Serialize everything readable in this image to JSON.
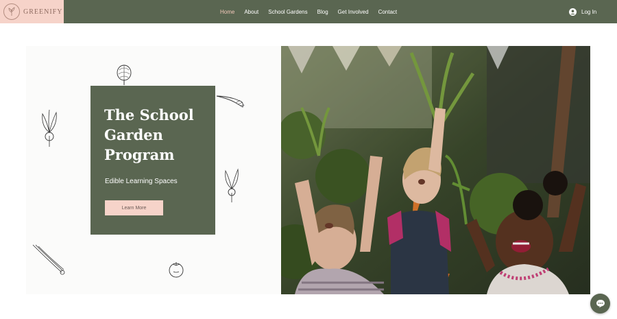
{
  "brand": {
    "name": "GREENIFY"
  },
  "nav": {
    "items": [
      {
        "label": "Home",
        "active": true
      },
      {
        "label": "About",
        "active": false
      },
      {
        "label": "School Gardens",
        "active": false
      },
      {
        "label": "Blog",
        "active": false
      },
      {
        "label": "Get Involved",
        "active": false
      },
      {
        "label": "Contact",
        "active": false
      }
    ],
    "login_label": "Log In"
  },
  "hero": {
    "title_lines": [
      "The School",
      "Garden",
      "Program"
    ],
    "subtitle": "Edible Learning Spaces",
    "cta_label": "Learn More",
    "photo_icon": "children-holding-vegetables-photo"
  },
  "colors": {
    "header_bg": "#5a6651",
    "logo_bg": "#f6d3c9",
    "card_bg": "#5a6651",
    "button_bg": "#f6d3c9",
    "active_nav": "#f3c8ba"
  },
  "chat": {
    "icon": "chat-bubble-icon"
  }
}
